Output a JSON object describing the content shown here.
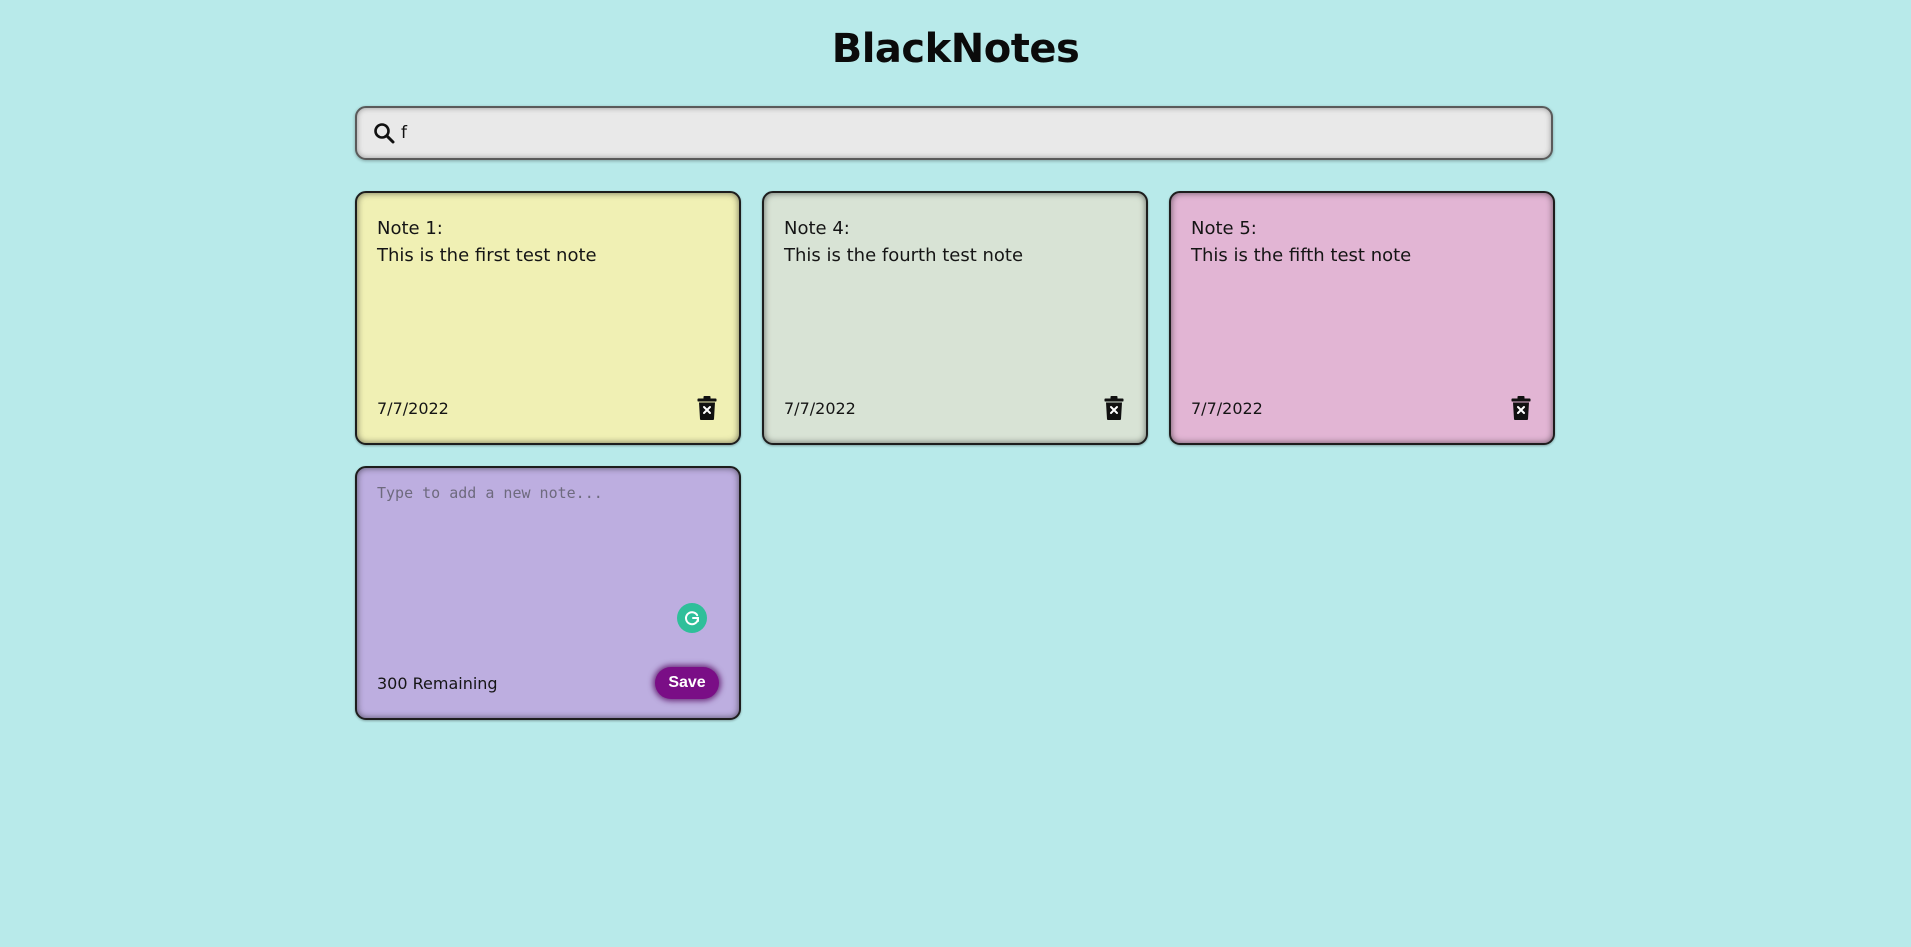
{
  "header": {
    "title": "BlackNotes"
  },
  "search": {
    "value": "f",
    "icon": "search-icon"
  },
  "notes": [
    {
      "text": "Note 1:\nThis is the first test note",
      "date": "7/7/2022",
      "color": "#f0f0b4",
      "delete_icon": "delete-icon"
    },
    {
      "text": "Note 4:\nThis is the fourth test note",
      "date": "7/7/2022",
      "color": "#d8e3d5",
      "delete_icon": "delete-icon"
    },
    {
      "text": "Note 5:\nThis is the fifth test note",
      "date": "7/7/2022",
      "color": "#e2b5d4",
      "delete_icon": "delete-icon"
    }
  ],
  "new_note": {
    "placeholder": "Type to add a new note...",
    "remaining": "300 Remaining",
    "save_label": "Save",
    "color": "#bdaee0",
    "grammar_icon": "grammarly-icon"
  },
  "colors": {
    "background": "#b8eaea",
    "save_button": "#7a0e86",
    "grammar_icon": "#2fbf9a"
  }
}
